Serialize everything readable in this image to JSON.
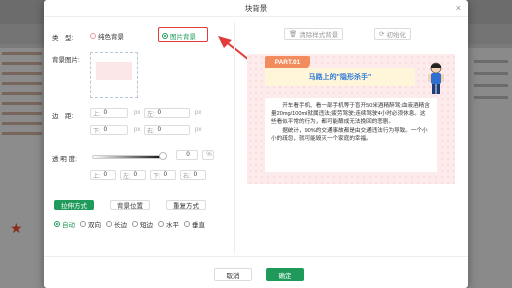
{
  "dialog": {
    "title": "块背景",
    "type_label": "类　型:",
    "type_options": [
      "纯色背景",
      "图片背景"
    ],
    "bg_image_label": "背景图片:",
    "margin_label": "边　距:",
    "margin": {
      "top_label": "上:",
      "top_value": "0",
      "top_unit": "px",
      "left_label": "左:",
      "left_value": "0",
      "left_unit": "px",
      "bottom_label": "下:",
      "bottom_value": "0",
      "bottom_unit": "px",
      "right_label": "右:",
      "right_value": "0",
      "right_unit": "px"
    },
    "opacity_label": "透 明 度:",
    "opacity_value": "0",
    "opacity_unit": "%",
    "crop": {
      "top_label": "上:",
      "top_value": "0",
      "left_label": "左:",
      "left_value": "0",
      "bottom_label": "下:",
      "bottom_value": "0",
      "right_label": "右:",
      "right_value": "0"
    },
    "mode_buttons": [
      "拉伸方式",
      "背景位置",
      "重复方式"
    ],
    "stretch_options": [
      "自动",
      "双向",
      "长边",
      "短边",
      "水平",
      "垂直"
    ],
    "clear_style_label": "清除样式背景",
    "reset_label": "初始化",
    "cancel_label": "取消",
    "ok_label": "确定",
    "close_symbol": "×"
  },
  "preview": {
    "badge": "PART.01",
    "title": "马路上的\"隐形杀手\"",
    "paragraphs": [
      "开车看手机、看一部手机等于盲开50米酒精醉驾;血液酒精含量20mg/100ml就属违法;疲劳驾驶;连续驾驶4小时必须休息。这些看似平常的行为，都可能酿成无法挽回的悲剧。",
      "据统计，90%的交通事故都是由交通违法行为导致。一个小小的疏忽，就可能毁灭一个家庭的幸福。"
    ]
  },
  "colors": {
    "accent": "#1f9a5a",
    "highlight": "#e23b3b",
    "badge": "#f28c5c",
    "title_text": "#2f79d8"
  }
}
